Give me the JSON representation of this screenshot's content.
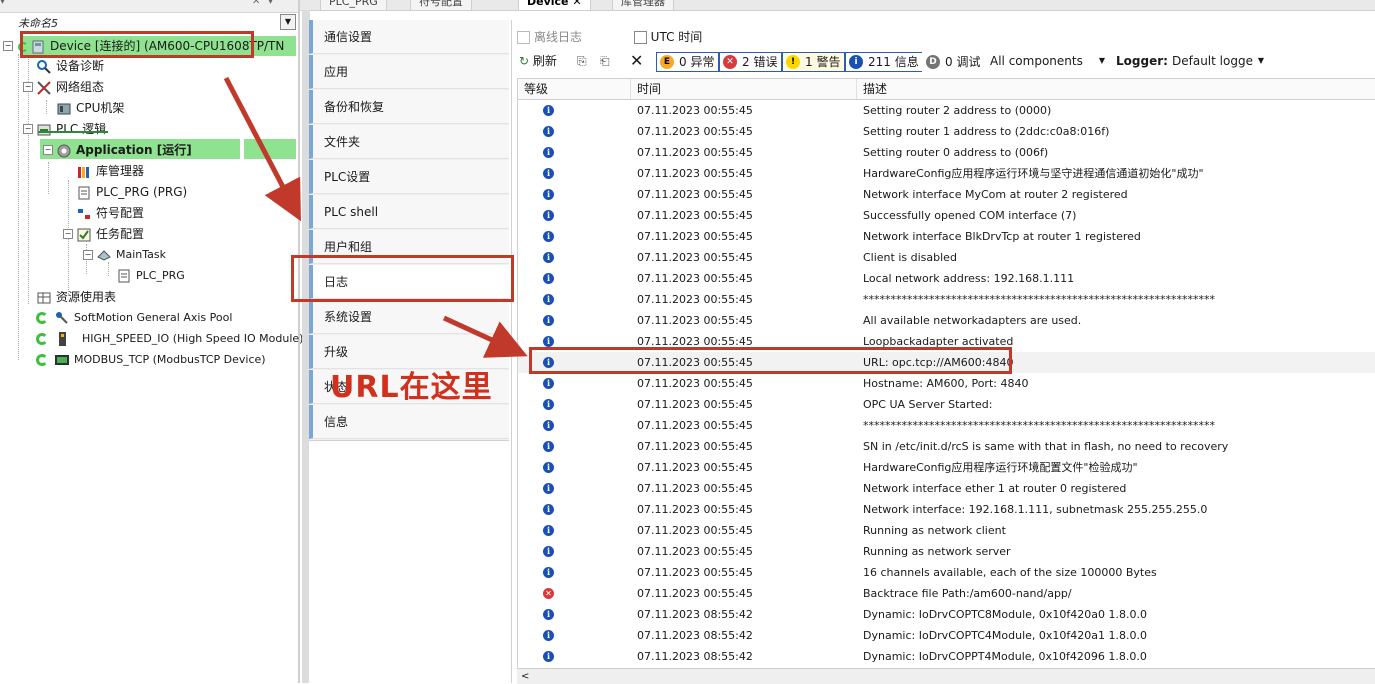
{
  "tabs": [
    {
      "label": "PLC_PRG",
      "active": false
    },
    {
      "label": "符号配置",
      "active": false
    },
    {
      "label": "Device",
      "active": true,
      "closable": true
    },
    {
      "label": "库管理器",
      "active": false
    }
  ],
  "tree": {
    "project_name": "未命名5",
    "items": [
      {
        "label": "Device [连接的] (AM600-CPU1608TP/TN",
        "icon": "device-icon"
      },
      {
        "label": "设备诊断",
        "icon": "diagnosis-icon"
      },
      {
        "label": "网络组态",
        "icon": "network-icon"
      },
      {
        "label": "CPU机架",
        "icon": "rack-icon"
      },
      {
        "label": "PLC 逻辑",
        "icon": "plc-logic-icon"
      },
      {
        "label": "Application [运行]",
        "icon": "gear-icon"
      },
      {
        "label": "库管理器",
        "icon": "library-icon"
      },
      {
        "label": "PLC_PRG (PRG)",
        "icon": "program-icon"
      },
      {
        "label": "符号配置",
        "icon": "symbol-icon"
      },
      {
        "label": "任务配置",
        "icon": "task-icon"
      },
      {
        "label": "MainTask",
        "icon": "task-cycle-icon"
      },
      {
        "label": "PLC_PRG",
        "icon": "program-icon"
      },
      {
        "label": "资源使用表",
        "icon": "table-icon"
      },
      {
        "label": "SoftMotion General Axis Pool",
        "icon": "axis-icon"
      },
      {
        "label": "HIGH_SPEED_IO (High Speed IO Module)",
        "icon": "io-module-icon"
      },
      {
        "label": "MODBUS_TCP (ModbusTCP Device)",
        "icon": "modbus-icon"
      }
    ]
  },
  "nav": {
    "items": [
      "通信设置",
      "应用",
      "备份和恢复",
      "文件夹",
      "PLC设置",
      "PLC shell",
      "用户和组",
      "日志",
      "系统设置",
      "升级",
      "状态",
      "信息"
    ],
    "selected": "日志"
  },
  "log": {
    "offline_log": "离线日志",
    "utc_time": "UTC 时间",
    "refresh": "刷新",
    "exceptions": "0 异常",
    "errors": "2 错误",
    "warnings": "1 警告",
    "infos": "211 信息",
    "debug": "0 调试",
    "components": "All components",
    "logger_label": "Logger:",
    "logger_value": "Default logge",
    "columns": {
      "level": "等级",
      "time": "时间",
      "desc": "描述"
    },
    "rows": [
      {
        "level": "info",
        "time": "07.11.2023 00:55:45",
        "desc": "Setting router 2 address to (0000)"
      },
      {
        "level": "info",
        "time": "07.11.2023 00:55:45",
        "desc": "Setting router 1 address to (2ddc:c0a8:016f)"
      },
      {
        "level": "info",
        "time": "07.11.2023 00:55:45",
        "desc": "Setting router 0 address to (006f)"
      },
      {
        "level": "info",
        "time": "07.11.2023 00:55:45",
        "desc": "HardwareConfig应用程序运行环境与坚守进程通信通道初始化\"成功\""
      },
      {
        "level": "info",
        "time": "07.11.2023 00:55:45",
        "desc": "Network interface MyCom at router 2 registered"
      },
      {
        "level": "info",
        "time": "07.11.2023 00:55:45",
        "desc": "Successfully opened COM interface (7)"
      },
      {
        "level": "info",
        "time": "07.11.2023 00:55:45",
        "desc": "Network interface BlkDrvTcp at router 1 registered"
      },
      {
        "level": "info",
        "time": "07.11.2023 00:55:45",
        "desc": "Client is disabled"
      },
      {
        "level": "info",
        "time": "07.11.2023 00:55:45",
        "desc": "Local network address: 192.168.1.111"
      },
      {
        "level": "info",
        "time": "07.11.2023 00:55:45",
        "desc": "****************************************************************"
      },
      {
        "level": "info",
        "time": "07.11.2023 00:55:45",
        "desc": "All available networkadapters are used."
      },
      {
        "level": "info",
        "time": "07.11.2023 00:55:45",
        "desc": "Loopbackadapter activated"
      },
      {
        "level": "info",
        "time": "07.11.2023 00:55:45",
        "desc": "URL: opc.tcp://AM600:4840"
      },
      {
        "level": "info",
        "time": "07.11.2023 00:55:45",
        "desc": "Hostname: AM600, Port: 4840"
      },
      {
        "level": "info",
        "time": "07.11.2023 00:55:45",
        "desc": "OPC UA Server Started:"
      },
      {
        "level": "info",
        "time": "07.11.2023 00:55:45",
        "desc": "****************************************************************"
      },
      {
        "level": "info",
        "time": "07.11.2023 00:55:45",
        "desc": "SN in /etc/init.d/rcS is same with that in flash, no need to recovery"
      },
      {
        "level": "info",
        "time": "07.11.2023 00:55:45",
        "desc": "HardwareConfig应用程序运行环境配置文件\"检验成功\""
      },
      {
        "level": "info",
        "time": "07.11.2023 00:55:45",
        "desc": "Network interface ether 1 at router 0 registered"
      },
      {
        "level": "info",
        "time": "07.11.2023 00:55:45",
        "desc": "Network interface: 192.168.1.111, subnetmask 255.255.255.0"
      },
      {
        "level": "info",
        "time": "07.11.2023 00:55:45",
        "desc": "Running as network client"
      },
      {
        "level": "info",
        "time": "07.11.2023 00:55:45",
        "desc": "Running as network server"
      },
      {
        "level": "info",
        "time": "07.11.2023 00:55:45",
        "desc": "16 channels available, each of the size 100000 Bytes"
      },
      {
        "level": "error",
        "time": "07.11.2023 00:55:45",
        "desc": "Backtrace file Path:/am600-nand/app/"
      },
      {
        "level": "info",
        "time": "07.11.2023 08:55:42",
        "desc": "Dynamic: IoDrvCOPTC8Module, 0x10f420a0 1.8.0.0"
      },
      {
        "level": "info",
        "time": "07.11.2023 08:55:42",
        "desc": "Dynamic: IoDrvCOPTC4Module, 0x10f420a1 1.8.0.0"
      },
      {
        "level": "info",
        "time": "07.11.2023 08:55:42",
        "desc": "Dynamic: IoDrvCOPPT4Module, 0x10f42096 1.8.0.0"
      }
    ]
  },
  "annotation": {
    "text": "URL在这里",
    "color": "#d0311c"
  },
  "colors": {
    "highlight_green": "#8fe28f",
    "nav_accent": "#7aa7d6",
    "info_blue": "#1b4fb3",
    "error_red": "#d83b3b",
    "annotation_red": "#c0392b"
  }
}
